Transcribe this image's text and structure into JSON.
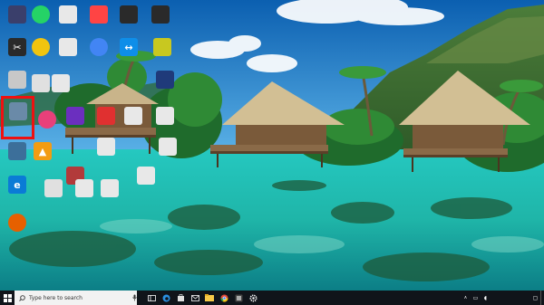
{
  "desktop": {
    "icons": [
      {
        "id": "icon-col1-1",
        "label": "",
        "glyph": "",
        "color": "#3a3f6b"
      },
      {
        "id": "icon-col1-2",
        "label": "",
        "glyph": "",
        "color": "#2a2a2a"
      },
      {
        "id": "icon-col1-3",
        "label": "",
        "glyph": "",
        "color": "#c8c8c8"
      },
      {
        "id": "icon-col1-4",
        "label": "",
        "glyph": "",
        "color": "#6a8aa8"
      },
      {
        "id": "icon-col1-5",
        "label": "",
        "glyph": "",
        "color": "#3c6f9a"
      },
      {
        "id": "icon-col1-6",
        "label": "",
        "glyph": "e",
        "color": "#0a7bd6"
      },
      {
        "id": "icon-col1-7",
        "label": "",
        "glyph": "",
        "color": "#e66000"
      },
      {
        "id": "icon-col2-1",
        "label": "",
        "glyph": "",
        "color": "#25d366"
      },
      {
        "id": "icon-col2-2",
        "label": "",
        "glyph": "",
        "color": "#f1c40f"
      },
      {
        "id": "icon-col2-3",
        "label": "",
        "glyph": "",
        "color": "#e0e0e0"
      },
      {
        "id": "icon-col2-4",
        "label": "",
        "glyph": "",
        "color": "#e8407a"
      },
      {
        "id": "icon-col2-5",
        "label": "",
        "glyph": "",
        "color": "#f39c12"
      },
      {
        "id": "icon-col2-6",
        "label": "",
        "glyph": "",
        "color": "#e0e0e0"
      },
      {
        "id": "icon-col3-1",
        "label": "",
        "glyph": "",
        "color": "#e8e8e8"
      },
      {
        "id": "icon-col3-2",
        "label": "",
        "glyph": "",
        "color": "#e8e8e8"
      },
      {
        "id": "icon-col3-3",
        "label": "",
        "glyph": "",
        "color": "#e8e8e8"
      },
      {
        "id": "icon-col3-4",
        "label": "",
        "glyph": "",
        "color": "#6b2fbf"
      },
      {
        "id": "icon-col3-5",
        "label": "",
        "glyph": "",
        "color": "#b23a3a"
      },
      {
        "id": "icon-col3-6",
        "label": "",
        "glyph": "",
        "color": "#e8e8e8"
      },
      {
        "id": "icon-col4-1",
        "label": "",
        "glyph": "",
        "color": "#ff4444"
      },
      {
        "id": "icon-col4-2",
        "label": "",
        "glyph": "",
        "color": "#4285f4"
      },
      {
        "id": "icon-col4-3",
        "label": "",
        "glyph": "",
        "color": "#e03030"
      },
      {
        "id": "icon-col4-4",
        "label": "",
        "glyph": "",
        "color": "#e8e8e8"
      },
      {
        "id": "icon-col4-5",
        "label": "",
        "glyph": "",
        "color": "#e8e8e8"
      },
      {
        "id": "icon-col5-1",
        "label": "",
        "glyph": "",
        "color": "#2a2a2a"
      },
      {
        "id": "icon-col5-2",
        "label": "",
        "glyph": "",
        "color": "#0e8ee9"
      },
      {
        "id": "icon-col5-3",
        "label": "",
        "glyph": "",
        "color": "#2a7fd0"
      },
      {
        "id": "icon-col5-4",
        "label": "",
        "glyph": "",
        "color": "#e8e8e8"
      },
      {
        "id": "icon-col5-5",
        "label": "",
        "glyph": "",
        "color": "#e8e8e8"
      },
      {
        "id": "icon-col6-1",
        "label": "",
        "glyph": "",
        "color": "#2a2a2a"
      },
      {
        "id": "icon-col6-2",
        "label": "",
        "glyph": "",
        "color": "#1f3a7a"
      },
      {
        "id": "icon-col6-3",
        "label": "",
        "glyph": "",
        "color": "#e8e8e8"
      },
      {
        "id": "icon-col6-4",
        "label": "",
        "glyph": "",
        "color": "#e8e8e8"
      },
      {
        "id": "icon-col7-1",
        "label": "",
        "glyph": "",
        "color": "#ffffff"
      },
      {
        "id": "icon-col7-2",
        "label": "",
        "glyph": "",
        "color": "#c8c820"
      },
      {
        "id": "icon-col7-3",
        "label": "",
        "glyph": "",
        "color": "#e8e8e8"
      },
      {
        "id": "icon-col7-4",
        "label": "",
        "glyph": "",
        "color": "#e8e8e8"
      },
      {
        "id": "icon-col8-1",
        "label": "",
        "glyph": "",
        "color": "#e8e8e8"
      }
    ],
    "highlight_color": "#ee1111"
  },
  "taskbar": {
    "search_placeholder": "Type here to search",
    "clock_time": "",
    "clock_date": "",
    "language": "",
    "background": "#10141a"
  }
}
